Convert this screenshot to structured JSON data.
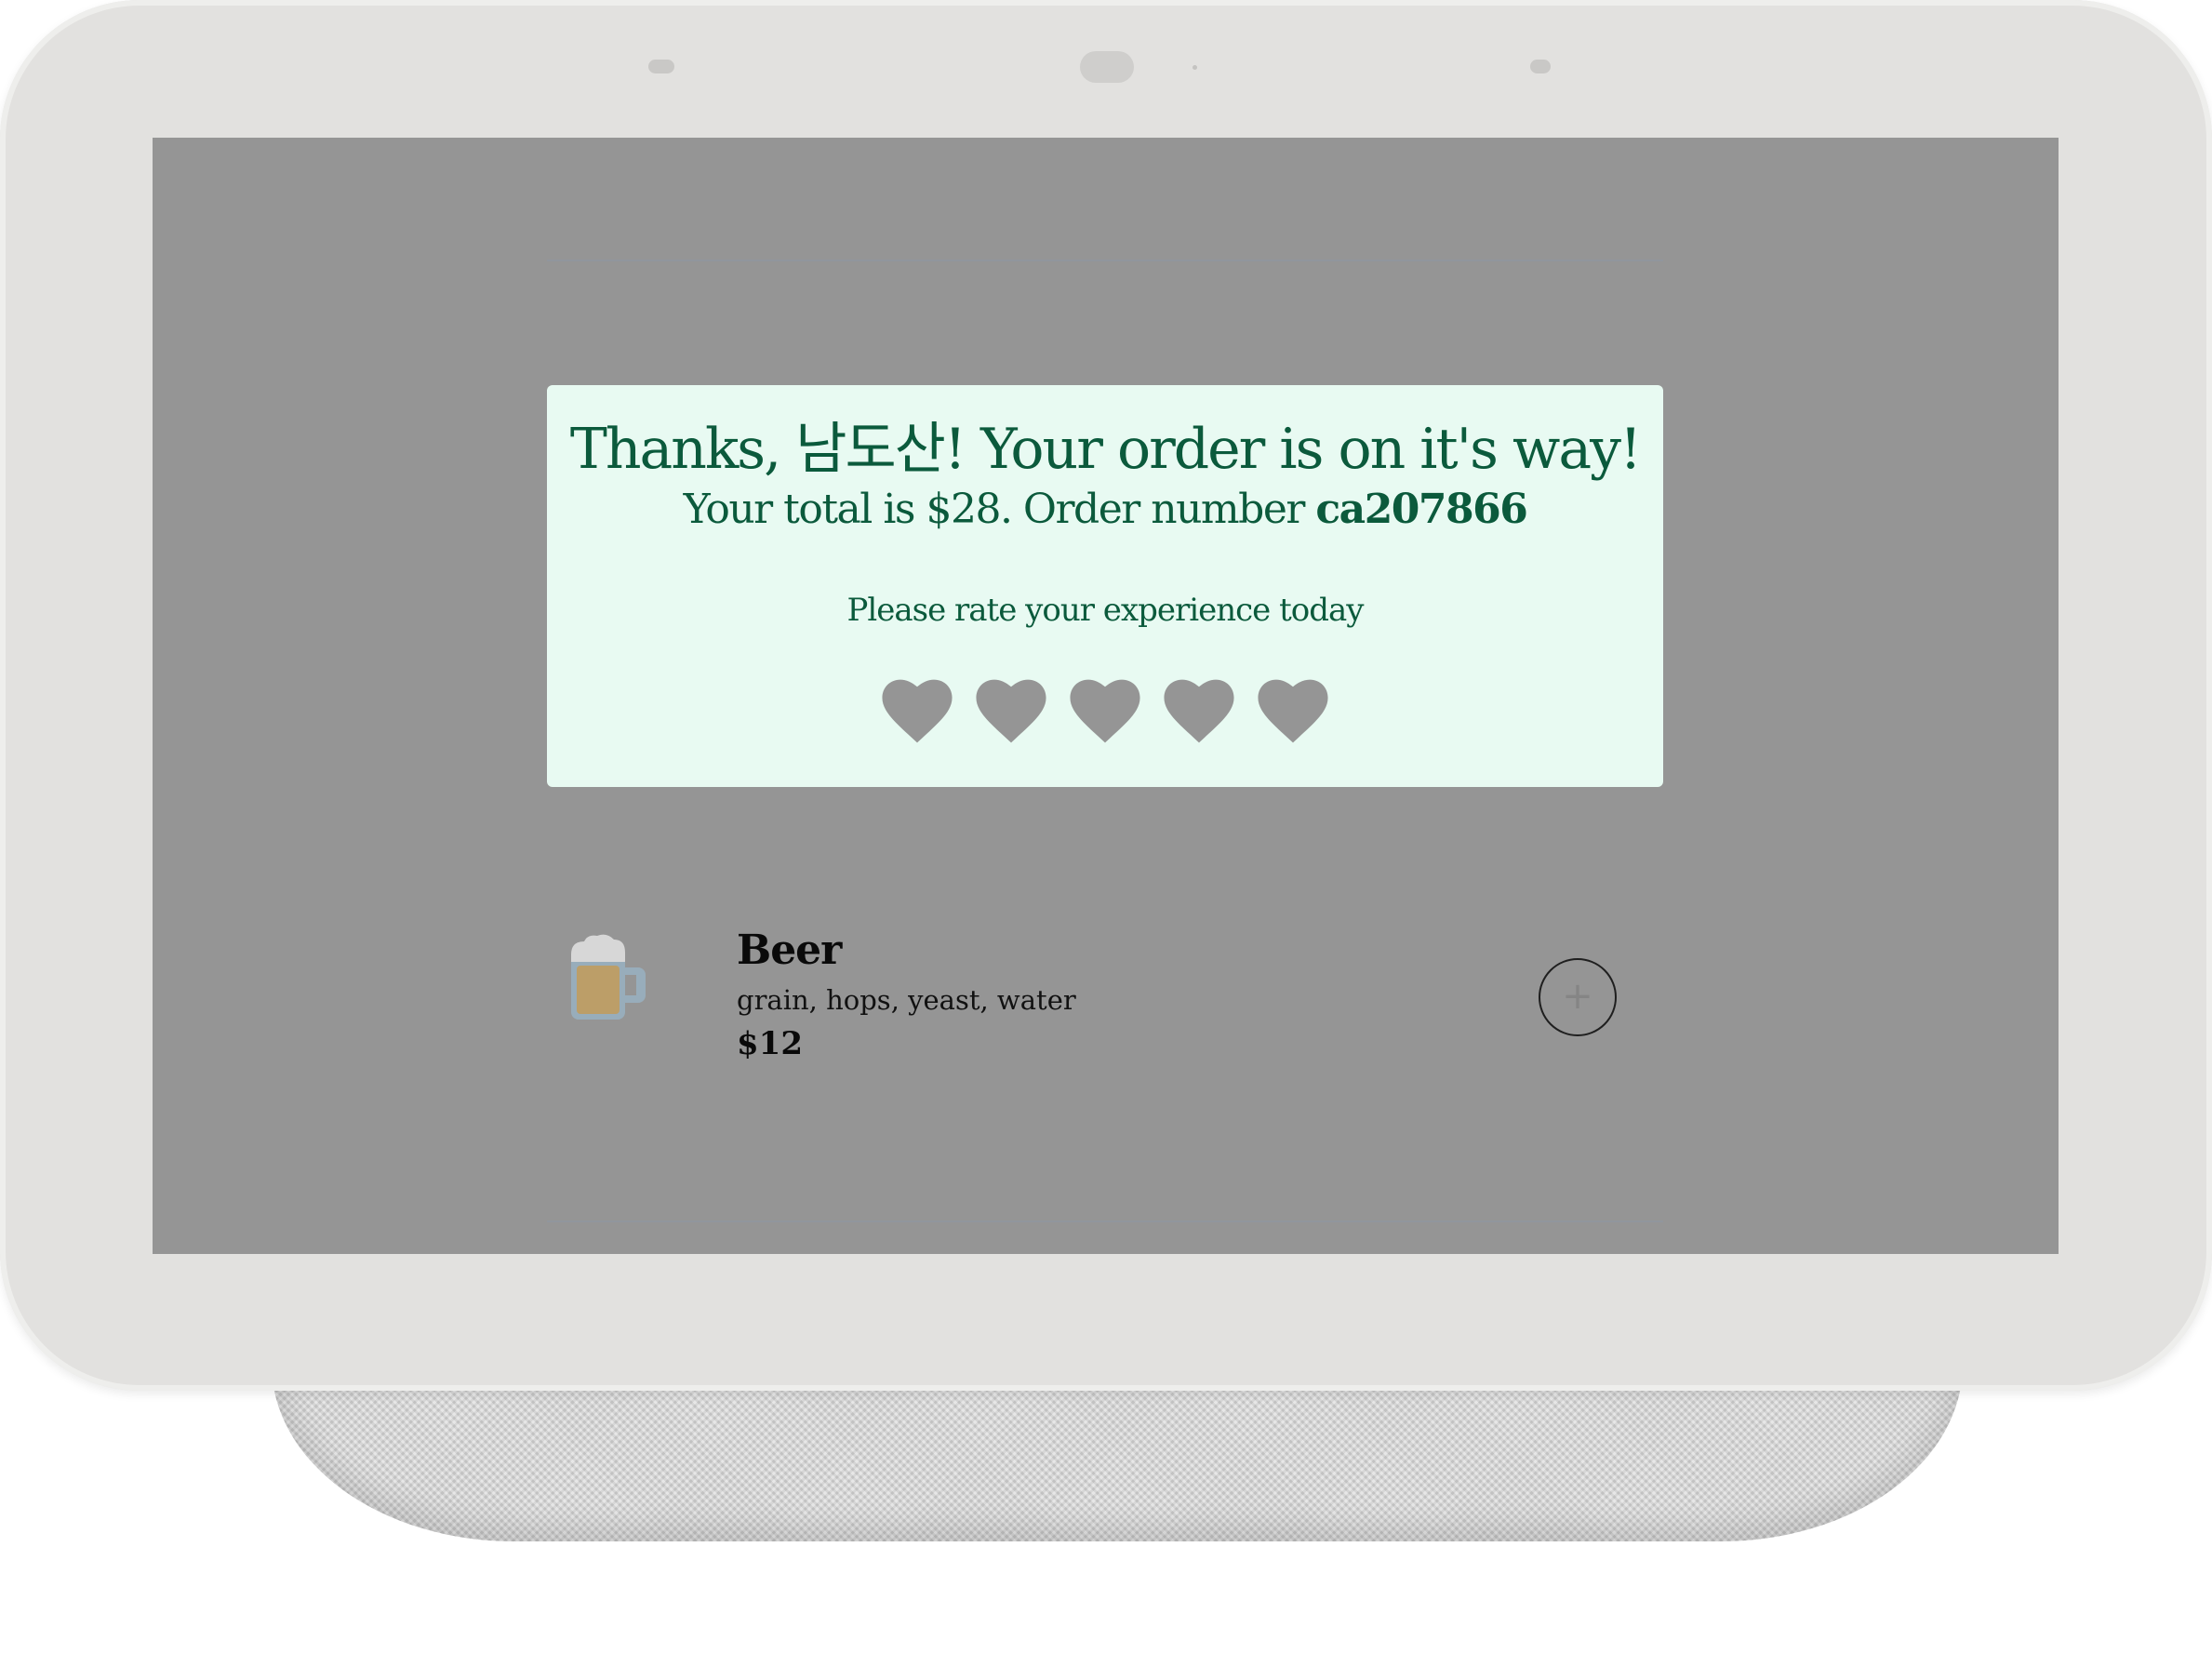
{
  "dialog": {
    "title": "Thanks, 남도산! Your order is on it's way!",
    "total_text": "Your total is $28. Order number",
    "order_number": "ca207866",
    "rate_prompt": "Please rate your experience today",
    "rating": {
      "max": 5,
      "selected": 0
    },
    "heart_color": "#959595",
    "background_color": "#e8faf2",
    "text_color": "#0b5a3c"
  },
  "menu_item": {
    "icon": "beer-mug-icon",
    "name": "Beer",
    "description": "grain, hops, yeast, water",
    "price": "$12",
    "add_button_symbol": "+"
  },
  "overlay_color": "#959595"
}
